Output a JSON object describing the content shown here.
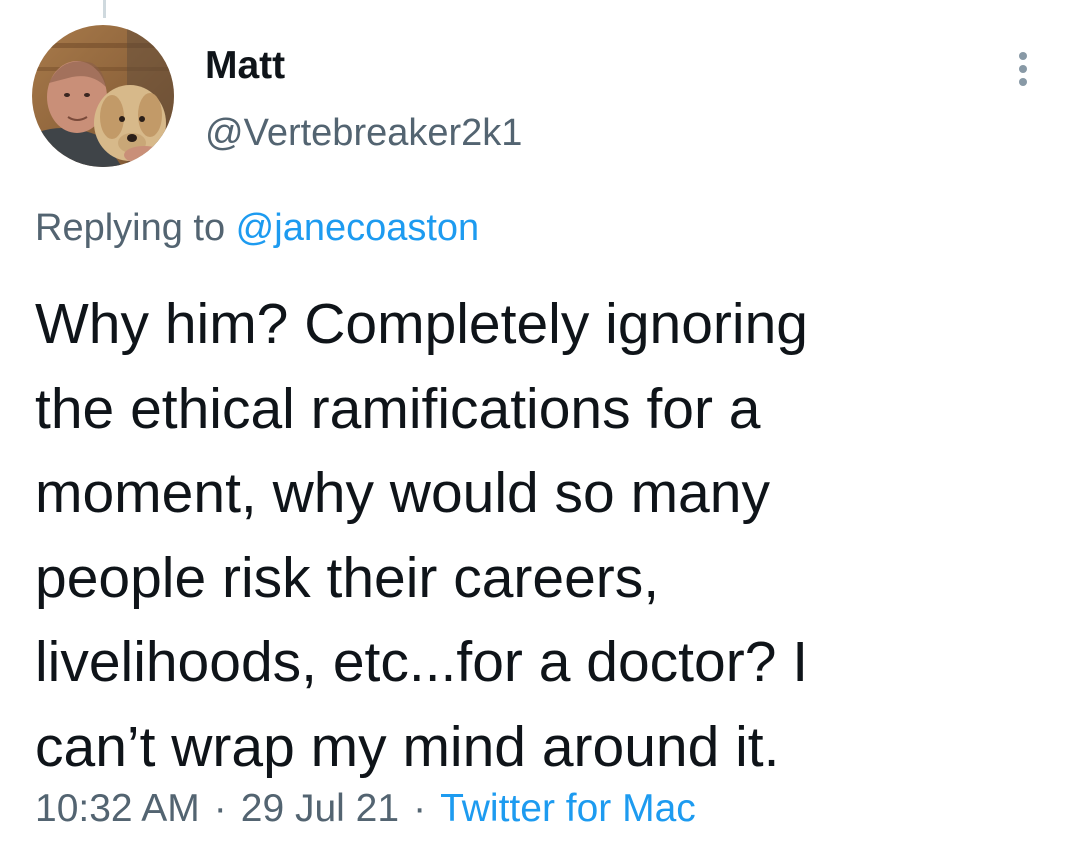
{
  "tweet": {
    "author": {
      "display_name": "Matt",
      "handle": "@Vertebreaker2k1",
      "avatar_icon": "profile-photo-man-with-dog"
    },
    "more_icon": "more-vertical-icon",
    "reply_context": {
      "prefix": "Replying to ",
      "mention": "@janecoaston"
    },
    "text_lines": [
      "Why him? Completely ignoring",
      "the ethical ramifications for a",
      "moment, why would so many",
      "people risk their careers,",
      "livelihoods, etc...for a doctor? I",
      "can’t wrap my mind around it."
    ],
    "time": "10:32 AM",
    "separator": "·",
    "date": "29 Jul 21",
    "source": "Twitter for Mac"
  },
  "colors": {
    "text_primary": "#0f1419",
    "text_secondary": "#536471",
    "link": "#1d9bf0",
    "thread_line": "#cfd9de"
  }
}
